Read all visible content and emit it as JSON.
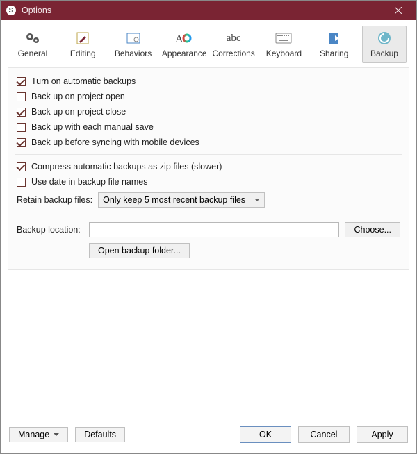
{
  "window": {
    "title": "Options"
  },
  "tabs": {
    "general": {
      "label": "General"
    },
    "editing": {
      "label": "Editing"
    },
    "behaviors": {
      "label": "Behaviors"
    },
    "appearance": {
      "label": "Appearance"
    },
    "corrections": {
      "label": "Corrections"
    },
    "keyboard": {
      "label": "Keyboard"
    },
    "sharing": {
      "label": "Sharing"
    },
    "backup": {
      "label": "Backup"
    }
  },
  "backup": {
    "opts": [
      {
        "label": "Turn on automatic backups",
        "checked": true
      },
      {
        "label": "Back up on project open",
        "checked": false
      },
      {
        "label": "Back up on project close",
        "checked": true
      },
      {
        "label": "Back up with each manual save",
        "checked": false
      },
      {
        "label": "Back up before syncing with mobile devices",
        "checked": true
      }
    ],
    "opts2": [
      {
        "label": "Compress automatic backups as zip files (slower)",
        "checked": true
      },
      {
        "label": "Use date in backup file names",
        "checked": false
      }
    ],
    "retain_label": "Retain backup files:",
    "retain_value": "Only keep 5 most recent backup files",
    "location_label": "Backup location:",
    "location_value": "",
    "choose_btn": "Choose...",
    "open_folder_btn": "Open backup folder..."
  },
  "footer": {
    "manage": "Manage",
    "defaults": "Defaults",
    "ok": "OK",
    "cancel": "Cancel",
    "apply": "Apply"
  }
}
